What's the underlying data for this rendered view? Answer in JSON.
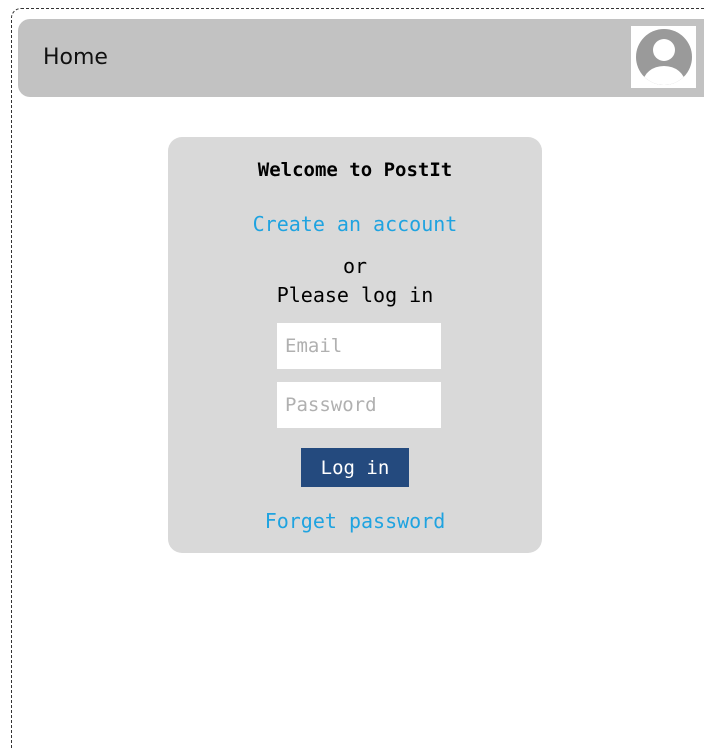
{
  "header": {
    "title": "Home",
    "avatar_icon": "user-avatar-icon"
  },
  "login_card": {
    "welcome": "Welcome to PostIt",
    "create_account": "Create an account",
    "or": "or",
    "login_prompt": "Please log in",
    "email": {
      "value": "",
      "placeholder": "Email"
    },
    "password": {
      "value": "",
      "placeholder": "Password"
    },
    "login_button": "Log in",
    "forget_password": "Forget password"
  },
  "colors": {
    "header_bg": "#c2c2c2",
    "card_bg": "#d9d9d9",
    "link": "#1fa3e0",
    "button_bg": "#244a7e",
    "button_text": "#ffffff"
  }
}
